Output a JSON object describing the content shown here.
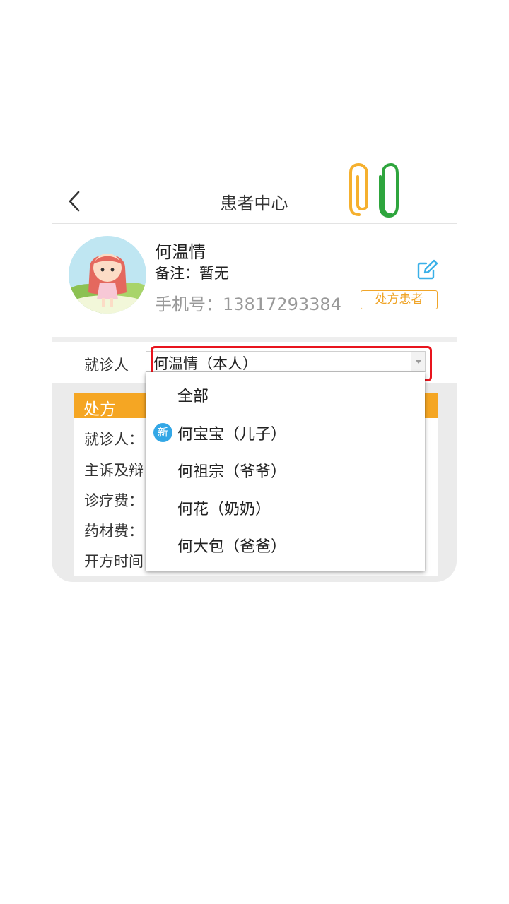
{
  "header": {
    "title": "患者中心"
  },
  "profile": {
    "name": "何温情",
    "note": "备注：暂无",
    "phone": "手机号：13817293384",
    "tag": "处方患者"
  },
  "patient_select": {
    "label": "就诊人",
    "selected": "何温情（本人）"
  },
  "dropdown": {
    "items": [
      {
        "label": "全部"
      },
      {
        "label": "何宝宝（儿子）",
        "badge": "新"
      },
      {
        "label": "何祖宗（爷爷）"
      },
      {
        "label": "何花（奶奶）"
      },
      {
        "label": "何大包（爸爸）"
      }
    ]
  },
  "prescription_card": {
    "title": "处方",
    "rows": [
      "就诊人：",
      "主诉及辩",
      "诊疗费：",
      "药材费：",
      "开方时间"
    ]
  },
  "colors": {
    "accent_orange": "#f5a623",
    "tag_orange": "#f0a529",
    "highlight_red": "#e8141d",
    "new_badge_blue": "#33a7e6",
    "edit_icon_blue": "#3ab0e8"
  }
}
